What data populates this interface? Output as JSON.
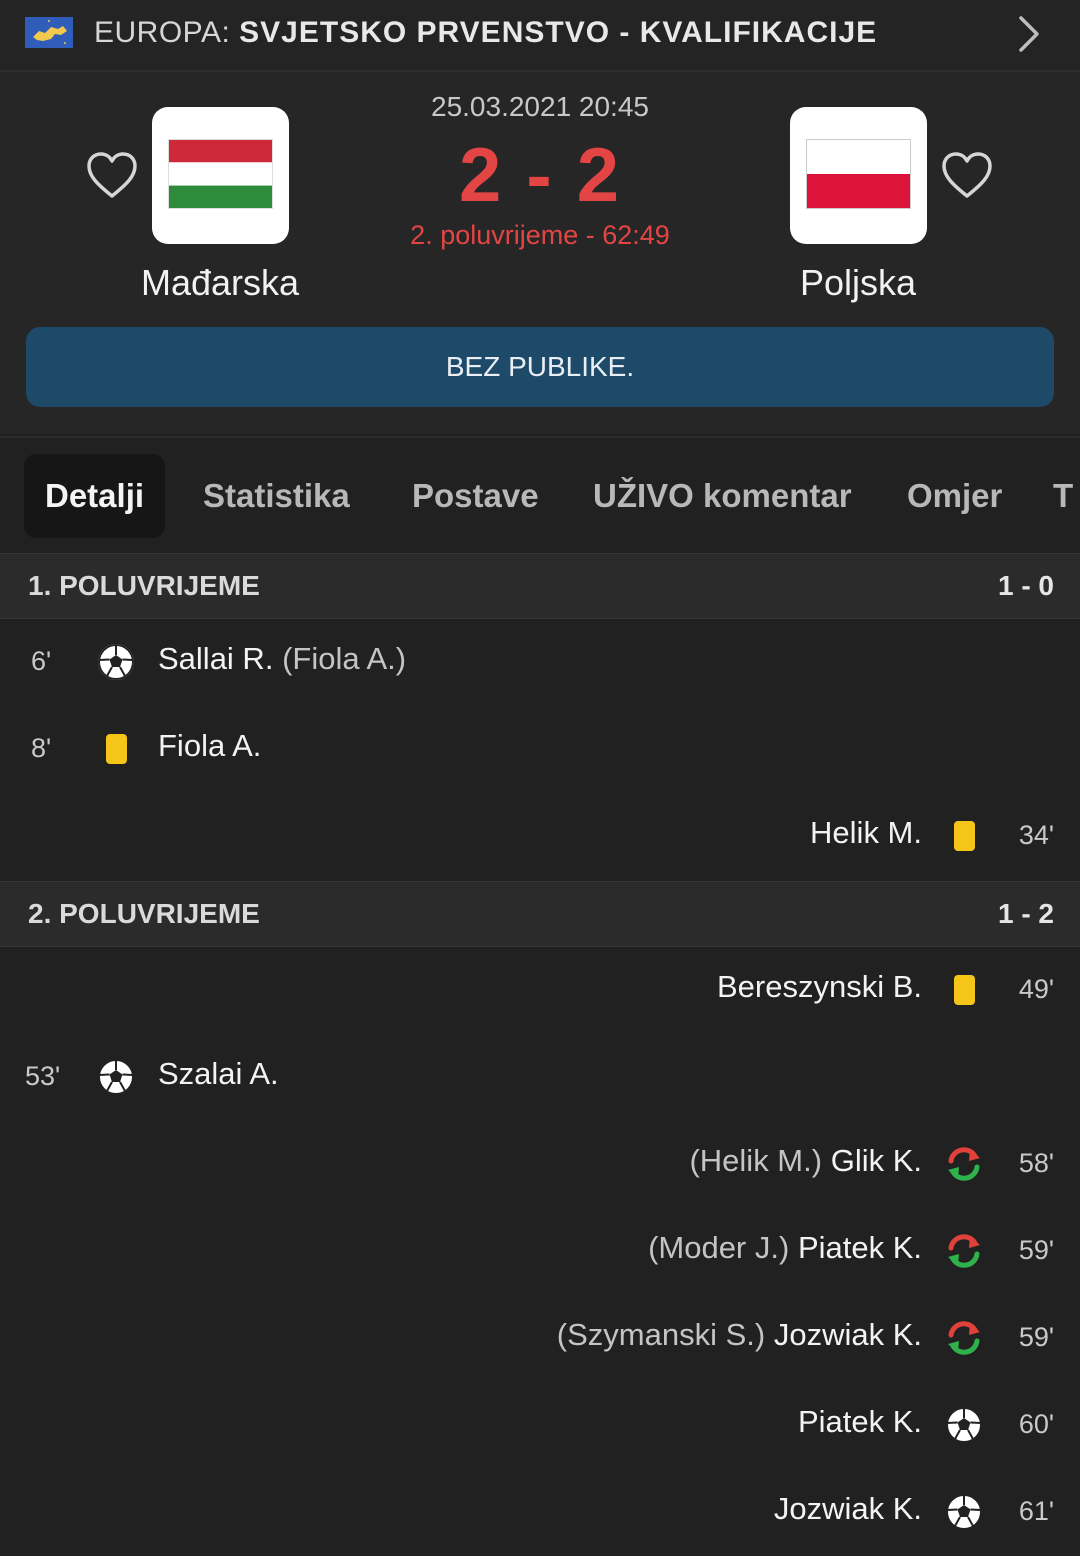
{
  "competition": {
    "region": "EUROPA:",
    "name": "SVJETSKO PRVENSTVO - KVALIFIKACIJE"
  },
  "match": {
    "datetime": "25.03.2021 20:45",
    "score": "2 - 2",
    "status": "2. poluvrijeme - 62:49",
    "home": {
      "name": "Mađarska",
      "flag_colors": [
        "#ce2939",
        "#ffffff",
        "#2e8b3c"
      ]
    },
    "away": {
      "name": "Poljska",
      "flag_colors": [
        "#ffffff",
        "#dc143c"
      ]
    },
    "notice": "BEZ PUBLIKE."
  },
  "tabs": [
    "Detalji",
    "Statistika",
    "Postave",
    "UŽIVO komentar",
    "Omjer",
    "T"
  ],
  "sections": [
    {
      "title": "1. POLUVRIJEME",
      "score": "1 - 0",
      "events": [
        {
          "side": "home",
          "minute": "6'",
          "icon": "goal-icon",
          "player": "Sallai R.",
          "extra": "(Fiola A.)"
        },
        {
          "side": "home",
          "minute": "8'",
          "icon": "yellow-card-icon",
          "player": "Fiola A.",
          "extra": ""
        },
        {
          "side": "away",
          "minute": "34'",
          "icon": "yellow-card-icon",
          "player": "Helik M.",
          "extra": ""
        }
      ]
    },
    {
      "title": "2. POLUVRIJEME",
      "score": "1 - 2",
      "events": [
        {
          "side": "away",
          "minute": "49'",
          "icon": "yellow-card-icon",
          "player": "Bereszynski B.",
          "extra": ""
        },
        {
          "side": "home",
          "minute": "53'",
          "icon": "goal-icon",
          "player": "Szalai A.",
          "extra": ""
        },
        {
          "side": "away",
          "minute": "58'",
          "icon": "substitution-icon",
          "player": "Glik K.",
          "extra": "(Helik M.)"
        },
        {
          "side": "away",
          "minute": "59'",
          "icon": "substitution-icon",
          "player": "Piatek K.",
          "extra": "(Moder J.)"
        },
        {
          "side": "away",
          "minute": "59'",
          "icon": "substitution-icon",
          "player": "Jozwiak K.",
          "extra": "(Szymanski S.)"
        },
        {
          "side": "away",
          "minute": "60'",
          "icon": "goal-icon",
          "player": "Piatek K.",
          "extra": ""
        },
        {
          "side": "away",
          "minute": "61'",
          "icon": "goal-icon",
          "player": "Jozwiak K.",
          "extra": ""
        }
      ]
    }
  ],
  "colors": {
    "score_red": "#e34545",
    "notice_bg": "#1e4a6a",
    "yellow_card": "#f5c518",
    "sub_green": "#2fb24c",
    "sub_red": "#e0413a"
  }
}
